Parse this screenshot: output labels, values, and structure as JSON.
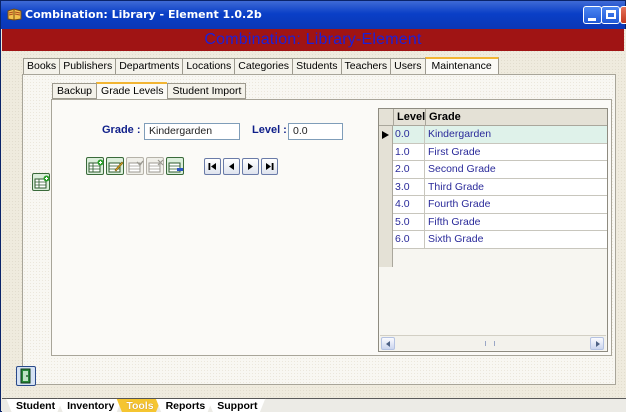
{
  "window": {
    "title": "Combination: Library - Element 1.0.2b"
  },
  "banner": {
    "text": "Combination:  Library-Element"
  },
  "main_tabs": [
    {
      "label": "Books"
    },
    {
      "label": "Publishers"
    },
    {
      "label": "Departments"
    },
    {
      "label": "Locations"
    },
    {
      "label": "Categories"
    },
    {
      "label": "Students"
    },
    {
      "label": "Teachers"
    },
    {
      "label": "Users"
    },
    {
      "label": "Maintenance",
      "active": true
    }
  ],
  "sub_tabs": [
    {
      "label": "Backup"
    },
    {
      "label": "Grade Levels",
      "active": true
    },
    {
      "label": "Student Import"
    }
  ],
  "form": {
    "grade_label": "Grade :",
    "grade_value": "Kindergarden",
    "level_label": "Level :",
    "level_value": "0.0"
  },
  "toolbar": {
    "icons": [
      "add-record-icon",
      "edit-record-icon",
      "save-record-icon",
      "cancel-edit-icon",
      "delete-record-icon"
    ],
    "nav_icons": [
      "first-record-icon",
      "previous-record-icon",
      "next-record-icon",
      "last-record-icon"
    ]
  },
  "grid": {
    "columns": [
      "Level",
      "Grade"
    ],
    "rows": [
      {
        "level": "0.0",
        "grade": "Kindergarden",
        "selected": true
      },
      {
        "level": "1.0",
        "grade": "First Grade"
      },
      {
        "level": "2.0",
        "grade": "Second Grade"
      },
      {
        "level": "3.0",
        "grade": "Third Grade"
      },
      {
        "level": "4.0",
        "grade": "Fourth Grade"
      },
      {
        "level": "5.0",
        "grade": "Fifth Grade"
      },
      {
        "level": "6.0",
        "grade": "Sixth Grade"
      }
    ]
  },
  "bottom_tabs": [
    {
      "label": "Student"
    },
    {
      "label": "Inventory"
    },
    {
      "label": "Tools",
      "active": true
    },
    {
      "label": "Reports"
    },
    {
      "label": "Support"
    }
  ],
  "colors": {
    "banner_bg": "#a01414",
    "banner_text": "#1c20d8",
    "active_tab_accent": "#f2b534",
    "selected_row": "#dff2ea"
  }
}
